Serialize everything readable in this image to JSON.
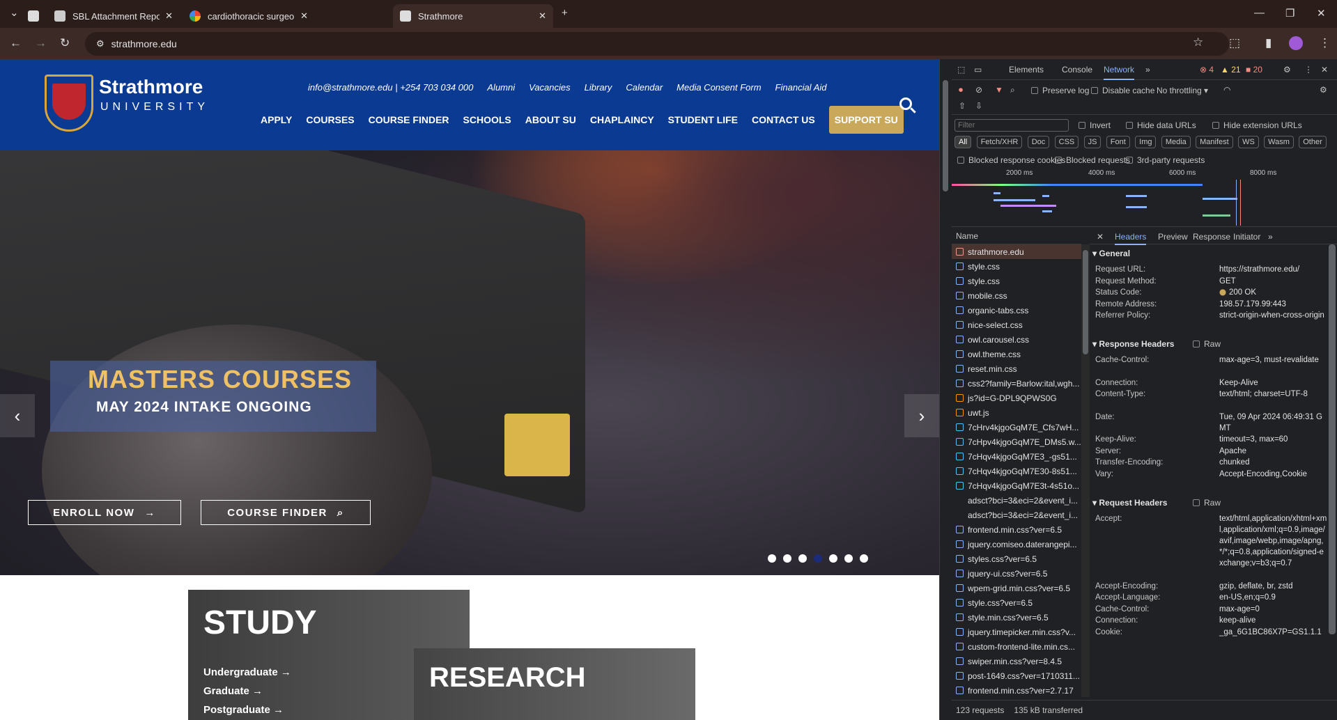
{
  "browser": {
    "tabs": [
      {
        "title": "SBL Attachment Report Guideli",
        "active": false
      },
      {
        "title": "cardiothoracic surgeon vs cardi",
        "active": false
      },
      {
        "title": "Strathmore",
        "active": true
      }
    ],
    "url": "strathmore.edu"
  },
  "site": {
    "logo_name": "Strathmore",
    "logo_sub": "UNIVERSITY",
    "top_links": [
      "info@strathmore.edu | +254 703 034 000",
      "Alumni",
      "Vacancies",
      "Library",
      "Calendar",
      "Media Consent Form",
      "Financial Aid"
    ],
    "main_nav": [
      "APPLY",
      "COURSES",
      "COURSE FINDER",
      "SCHOOLS",
      "ABOUT SU",
      "CHAPLAINCY",
      "STUDENT LIFE",
      "CONTACT US"
    ],
    "support_label": "SUPPORT SU",
    "hero": {
      "title": "MASTERS COURSES",
      "subtitle": "MAY 2024 INTAKE ONGOING",
      "enroll_label": "ENROLL NOW",
      "finder_label": "COURSE FINDER",
      "slide_count": 7,
      "current_slide": 4
    },
    "study": {
      "heading": "STUDY",
      "links": [
        "Undergraduate",
        "Graduate",
        "Postgraduate"
      ]
    },
    "research_heading": "RESEARCH"
  },
  "devtools": {
    "tabs": [
      "Elements",
      "Console",
      "Network"
    ],
    "active_tab": "Network",
    "errors": "4",
    "warnings": "21",
    "issues": "20",
    "preserve_log": "Preserve log",
    "disable_cache": "Disable cache",
    "throttling": "No throttling",
    "filter_placeholder": "Filter",
    "invert": "Invert",
    "hide_data_urls": "Hide data URLs",
    "hide_ext_urls": "Hide extension URLs",
    "type_filters": [
      "All",
      "Fetch/XHR",
      "Doc",
      "CSS",
      "JS",
      "Font",
      "Img",
      "Media",
      "Manifest",
      "WS",
      "Wasm",
      "Other"
    ],
    "blocked_cookies": "Blocked response cookies",
    "blocked_requests": "Blocked requests",
    "third_party": "3rd-party requests",
    "timeline_ticks": [
      "2000 ms",
      "4000 ms",
      "6000 ms",
      "8000 ms"
    ],
    "name_header": "Name",
    "requests": [
      {
        "name": "strathmore.edu",
        "type": "doc"
      },
      {
        "name": "style.css",
        "type": "css"
      },
      {
        "name": "style.css",
        "type": "css"
      },
      {
        "name": "mobile.css",
        "type": "css"
      },
      {
        "name": "organic-tabs.css",
        "type": "css"
      },
      {
        "name": "nice-select.css",
        "type": "css"
      },
      {
        "name": "owl.carousel.css",
        "type": "css"
      },
      {
        "name": "owl.theme.css",
        "type": "css"
      },
      {
        "name": "reset.min.css",
        "type": "css"
      },
      {
        "name": "css2?family=Barlow:ital,wgh...",
        "type": "css"
      },
      {
        "name": "js?id=G-DPL9QPWS0G",
        "type": "js"
      },
      {
        "name": "uwt.js",
        "type": "js"
      },
      {
        "name": "7cHrv4kjgoGqM7E_Cfs7wH...",
        "type": "font"
      },
      {
        "name": "7cHpv4kjgoGqM7E_DMs5.w...",
        "type": "font"
      },
      {
        "name": "7cHqv4kjgoGqM7E3_-gs51...",
        "type": "font"
      },
      {
        "name": "7cHqv4kjgoGqM7E30-8s51...",
        "type": "font"
      },
      {
        "name": "7cHqv4kjgoGqM7E3t-4s51o...",
        "type": "font"
      },
      {
        "name": "adsct?bci=3&eci=2&event_i...",
        "type": "none"
      },
      {
        "name": "adsct?bci=3&eci=2&event_i...",
        "type": "none"
      },
      {
        "name": "frontend.min.css?ver=6.5",
        "type": "css"
      },
      {
        "name": "jquery.comiseo.daterangepi...",
        "type": "css"
      },
      {
        "name": "styles.css?ver=6.5",
        "type": "css"
      },
      {
        "name": "jquery-ui.css?ver=6.5",
        "type": "css"
      },
      {
        "name": "wpem-grid.min.css?ver=6.5",
        "type": "css"
      },
      {
        "name": "style.css?ver=6.5",
        "type": "css"
      },
      {
        "name": "style.min.css?ver=6.5",
        "type": "css"
      },
      {
        "name": "jquery.timepicker.min.css?v...",
        "type": "css"
      },
      {
        "name": "custom-frontend-lite.min.cs...",
        "type": "css"
      },
      {
        "name": "swiper.min.css?ver=8.4.5",
        "type": "css"
      },
      {
        "name": "post-1649.css?ver=1710311...",
        "type": "css"
      },
      {
        "name": "frontend.min.css?ver=2.7.17",
        "type": "css"
      }
    ],
    "detail_tabs": [
      "Headers",
      "Preview",
      "Response",
      "Initiator"
    ],
    "general_label": "General",
    "general": [
      [
        "Request URL:",
        "https://strathmore.edu/"
      ],
      [
        "Request Method:",
        "GET"
      ],
      [
        "Status Code:",
        "200 OK"
      ],
      [
        "Remote Address:",
        "198.57.179.99:443"
      ],
      [
        "Referrer Policy:",
        "strict-origin-when-cross-origin"
      ]
    ],
    "response_headers_label": "Response Headers",
    "raw_label": "Raw",
    "response_headers": [
      [
        "Cache-Control:",
        "max-age=3, must-revalidate"
      ],
      [
        "Connection:",
        "Keep-Alive"
      ],
      [
        "Content-Type:",
        "text/html; charset=UTF-8"
      ],
      [
        "Date:",
        "Tue, 09 Apr 2024 06:49:31 GMT"
      ],
      [
        "Keep-Alive:",
        "timeout=3, max=60"
      ],
      [
        "Server:",
        "Apache"
      ],
      [
        "Transfer-Encoding:",
        "chunked"
      ],
      [
        "Vary:",
        "Accept-Encoding,Cookie"
      ]
    ],
    "request_headers_label": "Request Headers",
    "request_headers": [
      [
        "Accept:",
        "text/html,application/xhtml+xml,application/xml;q=0.9,image/avif,image/webp,image/apng,*/*;q=0.8,application/signed-exchange;v=b3;q=0.7"
      ],
      [
        "Accept-Encoding:",
        "gzip, deflate, br, zstd"
      ],
      [
        "Accept-Language:",
        "en-US,en;q=0.9"
      ],
      [
        "Cache-Control:",
        "max-age=0"
      ],
      [
        "Connection:",
        "keep-alive"
      ],
      [
        "Cookie:",
        "_ga_6G1BC86X7P=GS1.1.1"
      ]
    ],
    "requests_count": "123 requests",
    "transferred": "135 kB transferred"
  }
}
